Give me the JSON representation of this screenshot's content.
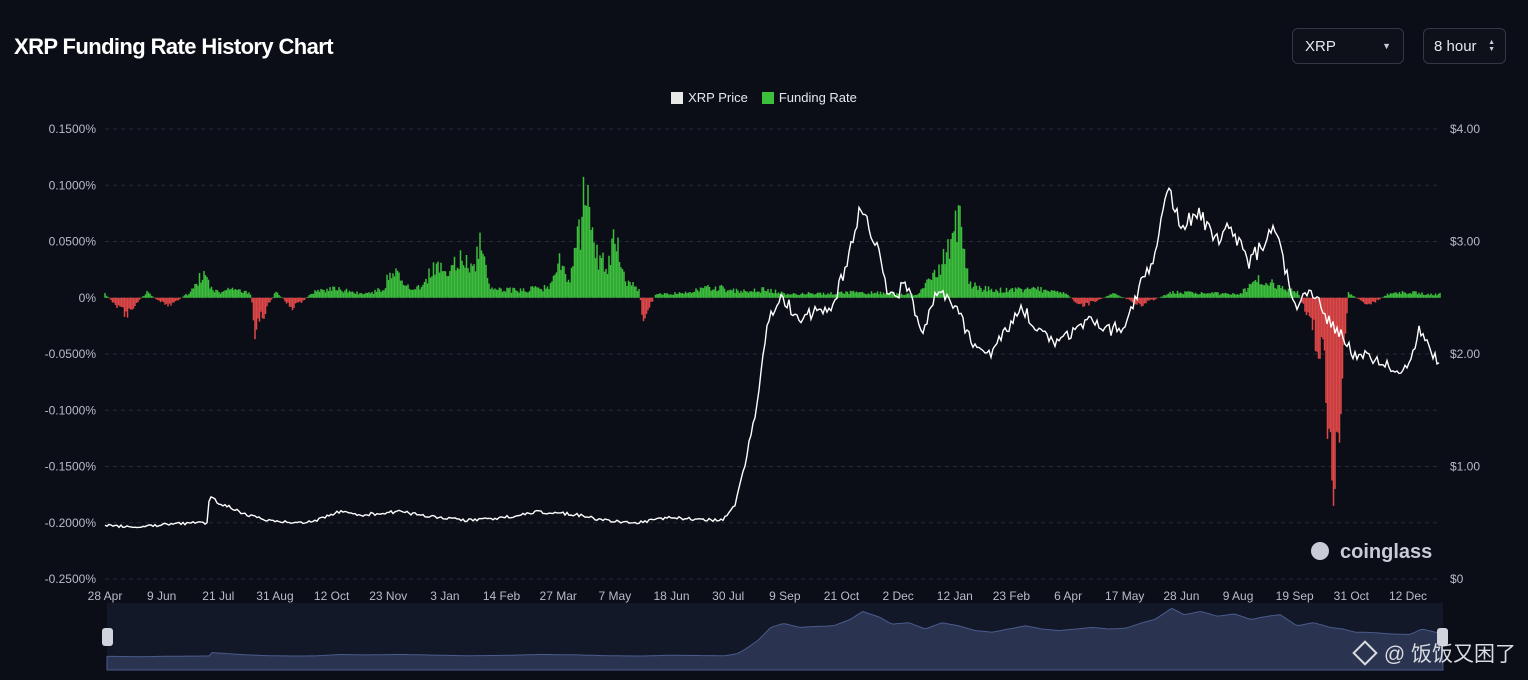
{
  "page": {
    "title": "XRP Funding Rate History Chart",
    "coin_select": "XRP",
    "interval_select": "8 hour",
    "watermark_brand": "coinglass",
    "watermark_author": "@ 饭饭又困了"
  },
  "colors": {
    "background": "#0b0e17",
    "price_line": "#ffffff",
    "funding_positive": "#3cbf3c",
    "funding_negative": "#e04848",
    "grid": "#262a35",
    "navigator_fill": "#2a3350"
  },
  "chart_data": {
    "type": "line",
    "title": "XRP Funding Rate History Chart",
    "legend": [
      "XRP Price",
      "Funding Rate"
    ],
    "legend_position": "top-center",
    "grid": true,
    "x_ticks": [
      "28 Apr",
      "9 Jun",
      "21 Jul",
      "31 Aug",
      "12 Oct",
      "23 Nov",
      "3 Jan",
      "14 Feb",
      "27 Mar",
      "7 May",
      "18 Jun",
      "30 Jul",
      "9 Sep",
      "21 Oct",
      "2 Dec",
      "12 Jan",
      "23 Feb",
      "6 Apr",
      "17 May",
      "28 Jun",
      "9 Aug",
      "19 Sep",
      "31 Oct",
      "12 Dec"
    ],
    "y_left": {
      "ticks": [
        "0.1500%",
        "0.1000%",
        "0.0500%",
        "0%",
        "-0.0500%",
        "-0.1000%",
        "-0.1500%",
        "-0.2000%",
        "-0.2500%"
      ],
      "range": [
        -0.25,
        0.15
      ]
    },
    "y_right": {
      "ticks": [
        "$4.00",
        "$3.00",
        "$2.00",
        "$1.00",
        "$0"
      ],
      "range": [
        0,
        4
      ]
    },
    "series": [
      {
        "name": "XRP Price",
        "axis": "right",
        "points": [
          [
            0,
            0.48
          ],
          [
            0.8,
            0.46
          ],
          [
            1.6,
            0.49
          ],
          [
            2.2,
            0.5
          ],
          [
            2.45,
            0.5
          ],
          [
            2.5,
            0.72
          ],
          [
            2.8,
            0.67
          ],
          [
            3.3,
            0.58
          ],
          [
            3.9,
            0.52
          ],
          [
            4.5,
            0.5
          ],
          [
            5.0,
            0.51
          ],
          [
            5.6,
            0.6
          ],
          [
            6.2,
            0.57
          ],
          [
            7.0,
            0.6
          ],
          [
            7.8,
            0.56
          ],
          [
            8.6,
            0.52
          ],
          [
            9.5,
            0.54
          ],
          [
            10.4,
            0.6
          ],
          [
            11.3,
            0.57
          ],
          [
            12.0,
            0.52
          ],
          [
            12.8,
            0.5
          ],
          [
            13.5,
            0.55
          ],
          [
            14.2,
            0.53
          ],
          [
            14.8,
            0.52
          ],
          [
            15.1,
            0.65
          ],
          [
            15.3,
            0.95
          ],
          [
            15.6,
            1.5
          ],
          [
            15.9,
            2.3
          ],
          [
            16.2,
            2.55
          ],
          [
            16.6,
            2.3
          ],
          [
            16.9,
            2.35
          ],
          [
            17.4,
            2.4
          ],
          [
            17.8,
            2.8
          ],
          [
            18.1,
            3.3
          ],
          [
            18.5,
            2.95
          ],
          [
            18.8,
            2.5
          ],
          [
            19.2,
            2.6
          ],
          [
            19.6,
            2.2
          ],
          [
            20.0,
            2.6
          ],
          [
            20.4,
            2.4
          ],
          [
            20.8,
            2.1
          ],
          [
            21.2,
            2.0
          ],
          [
            21.6,
            2.2
          ],
          [
            22.0,
            2.4
          ],
          [
            22.4,
            2.2
          ],
          [
            22.8,
            2.1
          ],
          [
            23.2,
            2.2
          ],
          [
            23.6,
            2.3
          ],
          [
            24.0,
            2.2
          ],
          [
            24.4,
            2.25
          ],
          [
            24.8,
            2.6
          ],
          [
            25.1,
            2.8
          ],
          [
            25.5,
            3.5
          ],
          [
            25.8,
            3.1
          ],
          [
            26.2,
            3.3
          ],
          [
            26.6,
            3.0
          ],
          [
            27.0,
            3.15
          ],
          [
            27.4,
            2.8
          ],
          [
            27.8,
            3.0
          ],
          [
            28.1,
            3.1
          ],
          [
            28.5,
            2.4
          ],
          [
            28.9,
            2.6
          ],
          [
            29.3,
            2.3
          ],
          [
            29.6,
            2.2
          ],
          [
            29.9,
            2.0
          ],
          [
            30.3,
            1.98
          ],
          [
            30.7,
            1.9
          ],
          [
            31.2,
            1.85
          ],
          [
            31.5,
            2.2
          ],
          [
            31.9,
            1.95
          ]
        ]
      },
      {
        "name": "Funding Rate",
        "axis": "left",
        "unit": "%",
        "points": [
          [
            0,
            0.004
          ],
          [
            0.5,
            -0.018
          ],
          [
            1.0,
            0.006
          ],
          [
            1.5,
            -0.01
          ],
          [
            2.0,
            0.005
          ],
          [
            2.35,
            0.025
          ],
          [
            2.6,
            0.006
          ],
          [
            3.1,
            0.01
          ],
          [
            3.5,
            0.005
          ],
          [
            3.6,
            -0.036
          ],
          [
            4.1,
            0.007
          ],
          [
            4.5,
            -0.012
          ],
          [
            5.0,
            0.006
          ],
          [
            5.5,
            0.01
          ],
          [
            6.0,
            0.006
          ],
          [
            6.4,
            0.005
          ],
          [
            6.7,
            0.012
          ],
          [
            6.9,
            0.035
          ],
          [
            7.2,
            0.012
          ],
          [
            7.6,
            0.01
          ],
          [
            7.9,
            0.04
          ],
          [
            8.2,
            0.02
          ],
          [
            8.5,
            0.045
          ],
          [
            8.8,
            0.03
          ],
          [
            9.0,
            0.065
          ],
          [
            9.2,
            0.012
          ],
          [
            9.6,
            0.009
          ],
          [
            10.0,
            0.008
          ],
          [
            10.4,
            0.011
          ],
          [
            10.7,
            0.012
          ],
          [
            10.9,
            0.04
          ],
          [
            11.1,
            0.015
          ],
          [
            11.3,
            0.06
          ],
          [
            11.55,
            0.124
          ],
          [
            11.7,
            0.05
          ],
          [
            12.0,
            0.035
          ],
          [
            12.3,
            0.07
          ],
          [
            12.5,
            0.018
          ],
          [
            12.8,
            0.008
          ],
          [
            12.9,
            -0.025
          ],
          [
            13.2,
            0.004
          ],
          [
            14.0,
            0.006
          ],
          [
            14.6,
            0.012
          ],
          [
            15.2,
            0.007
          ],
          [
            15.9,
            0.009
          ],
          [
            16.4,
            0.004
          ],
          [
            17.0,
            0.005
          ],
          [
            17.8,
            0.006
          ],
          [
            18.8,
            0.005
          ],
          [
            19.5,
            0.003
          ],
          [
            20.0,
            0.035
          ],
          [
            20.3,
            0.06
          ],
          [
            20.5,
            0.09
          ],
          [
            20.7,
            0.015
          ],
          [
            21.0,
            0.01
          ],
          [
            21.6,
            0.008
          ],
          [
            22.3,
            0.01
          ],
          [
            23.0,
            0.006
          ],
          [
            23.4,
            -0.01
          ],
          [
            24.2,
            0.005
          ],
          [
            24.8,
            -0.008
          ],
          [
            25.6,
            0.006
          ],
          [
            26.4,
            0.005
          ],
          [
            27.2,
            0.004
          ],
          [
            27.6,
            0.02
          ],
          [
            28.2,
            0.012
          ],
          [
            28.6,
            0.006
          ],
          [
            29.2,
            -0.065
          ],
          [
            29.5,
            -0.215
          ],
          [
            29.8,
            0.005
          ],
          [
            30.3,
            -0.008
          ],
          [
            30.8,
            0.005
          ],
          [
            31.3,
            0.006
          ],
          [
            31.9,
            0.004
          ]
        ]
      }
    ]
  }
}
